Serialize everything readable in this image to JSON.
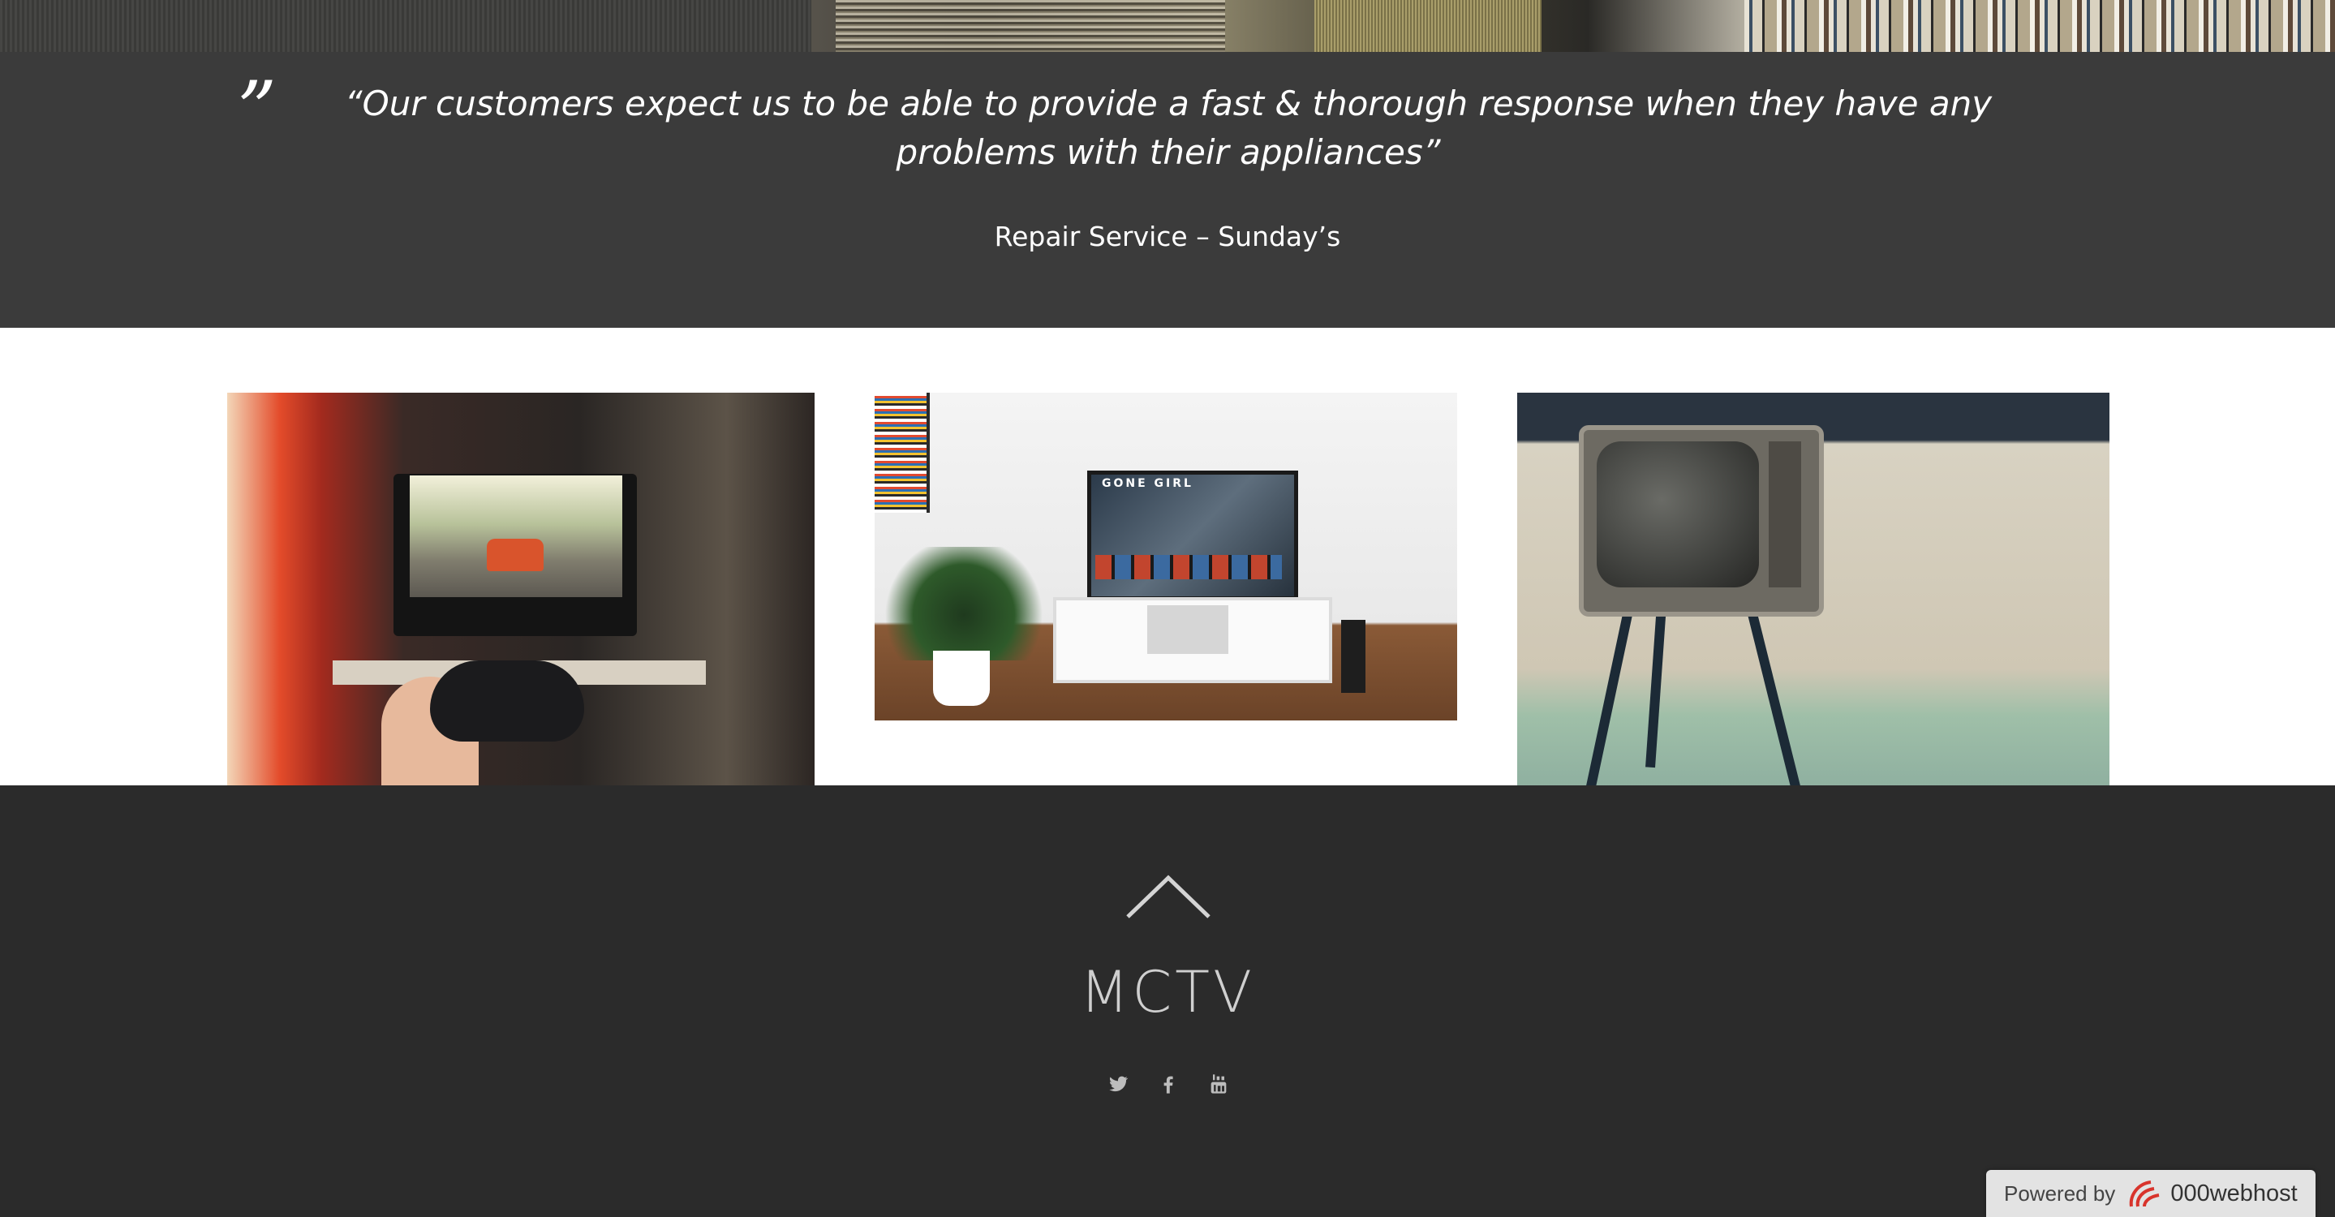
{
  "testimonial": {
    "quote_mark": "”",
    "quote": "“Our customers expect us to be able to provide a fast & thorough response when they have any problems with their appliances”",
    "author": "Repair Service – Sunday’s"
  },
  "gallery": {
    "tv_screen_title": "GONE GIRL"
  },
  "footer": {
    "brand": "MCTV",
    "social": [
      "twitter-icon",
      "facebook-icon",
      "youtube-icon"
    ]
  },
  "powered_badge": {
    "label": "Powered by",
    "host": "000webhost"
  }
}
